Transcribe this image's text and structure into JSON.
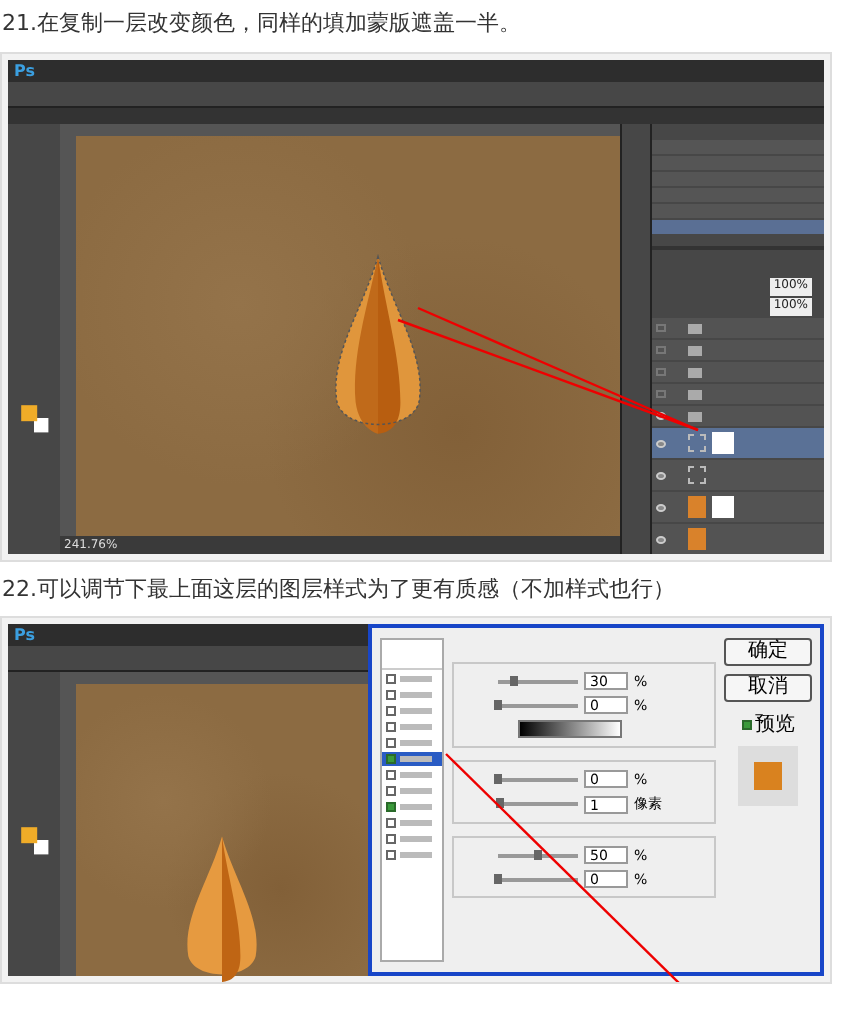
{
  "step_21": {
    "caption": "21.在复制一层改变颜色，同样的填加蒙版遮盖一半。",
    "app_logo": "Ps",
    "zoom_readout": "241.76%",
    "opacity": "100%",
    "fill": "100%",
    "history_items": [
      {
        "selected": false
      },
      {
        "selected": false
      },
      {
        "selected": false
      },
      {
        "selected": false
      },
      {
        "selected": false
      },
      {
        "selected": true
      }
    ],
    "layers": [
      {
        "kind": "folder",
        "visible": false,
        "selected": false,
        "mask": false
      },
      {
        "kind": "folder",
        "visible": false,
        "selected": false,
        "mask": false
      },
      {
        "kind": "folder",
        "visible": false,
        "selected": false,
        "mask": false
      },
      {
        "kind": "folder",
        "visible": false,
        "selected": false,
        "mask": false
      },
      {
        "kind": "folder",
        "visible": true,
        "selected": false,
        "mask": false
      },
      {
        "kind": "shape",
        "visible": true,
        "selected": true,
        "mask": true
      },
      {
        "kind": "shape",
        "visible": true,
        "selected": false,
        "mask": false
      },
      {
        "kind": "pixel",
        "visible": true,
        "selected": false,
        "mask": true
      },
      {
        "kind": "pixel",
        "visible": true,
        "selected": false,
        "mask": false
      }
    ]
  },
  "step_22": {
    "caption": "22.可以调节下最上面这层的图层样式为了更有质感（不加样式也行）",
    "app_logo": "Ps",
    "style_list": [
      {
        "checked": false,
        "selected": false
      },
      {
        "checked": false,
        "selected": false
      },
      {
        "checked": false,
        "selected": false
      },
      {
        "checked": false,
        "selected": false
      },
      {
        "checked": false,
        "selected": false
      },
      {
        "checked": true,
        "selected": true
      },
      {
        "checked": false,
        "selected": false
      },
      {
        "checked": false,
        "selected": false
      },
      {
        "checked": true,
        "selected": false
      },
      {
        "checked": false,
        "selected": false
      },
      {
        "checked": false,
        "selected": false
      },
      {
        "checked": false,
        "selected": false
      }
    ],
    "sliders": [
      {
        "value": "30",
        "unit": "%",
        "level": 0.2
      },
      {
        "value": "0",
        "unit": "%",
        "level": 0
      },
      {
        "value": "0",
        "unit": "%",
        "level": 0
      },
      {
        "value": "1",
        "unit": "像素",
        "level": 0.02
      },
      {
        "value": "50",
        "unit": "%",
        "level": 0.5
      },
      {
        "value": "0",
        "unit": "%",
        "level": 0
      }
    ],
    "buttons": [
      "确定",
      "取消"
    ],
    "preview": {
      "label": "预览",
      "checked": true
    }
  }
}
